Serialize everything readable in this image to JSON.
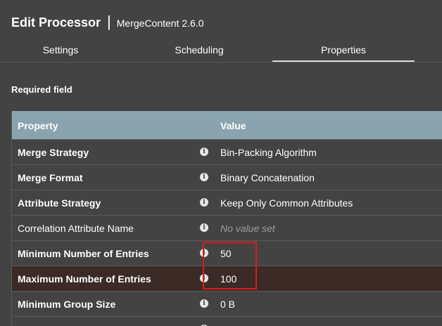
{
  "dialog": {
    "title": "Edit Processor",
    "separator": "|",
    "subtitle": "MergeContent 2.6.0"
  },
  "tabs": [
    {
      "label": "Settings",
      "active": false
    },
    {
      "label": "Scheduling",
      "active": false
    },
    {
      "label": "Properties",
      "active": true
    }
  ],
  "required_label": "Required field",
  "table": {
    "headers": {
      "property": "Property",
      "value": "Value"
    },
    "rows": [
      {
        "name": "Merge Strategy",
        "value": "Bin-Packing Algorithm",
        "required": true,
        "empty": false
      },
      {
        "name": "Merge Format",
        "value": "Binary Concatenation",
        "required": true,
        "empty": false
      },
      {
        "name": "Attribute Strategy",
        "value": "Keep Only Common Attributes",
        "required": true,
        "empty": false
      },
      {
        "name": "Correlation Attribute Name",
        "value": "No value set",
        "required": false,
        "empty": true
      },
      {
        "name": "Minimum Number of Entries",
        "value": "50",
        "required": true,
        "empty": false
      },
      {
        "name": "Maximum Number of Entries",
        "value": "100",
        "required": true,
        "empty": false,
        "selected": true
      },
      {
        "name": "Minimum Group Size",
        "value": "0 B",
        "required": true,
        "empty": false
      },
      {
        "name": "Maximum Group Size",
        "value": "",
        "required": true,
        "empty": false
      }
    ]
  },
  "icons": {
    "info": "info-icon",
    "info_glyph": "i"
  },
  "colors": {
    "background": "#434343",
    "header_row": "#8ba3ae",
    "selected_row": "#3b2a25",
    "highlight_box": "#e01818",
    "active_tab_underline": "#d9dee2"
  }
}
